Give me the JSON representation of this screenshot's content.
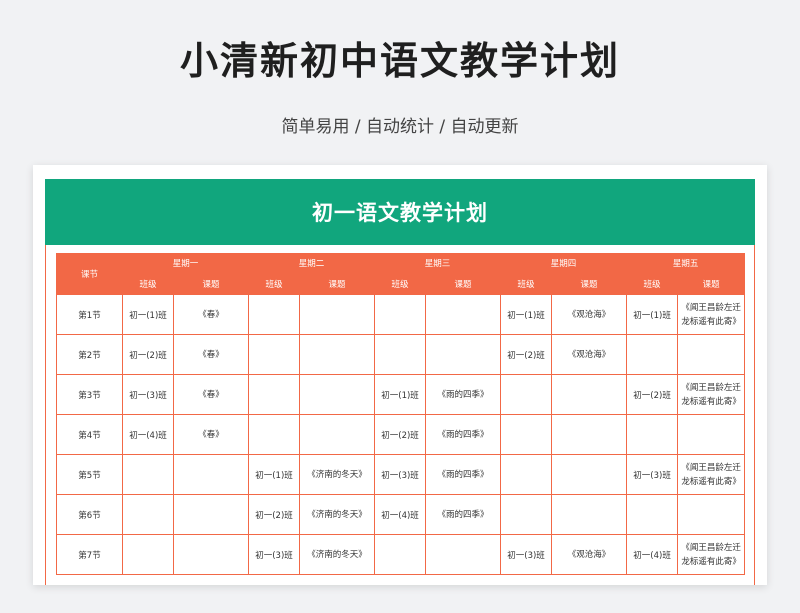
{
  "header": {
    "title": "小清新初中语文教学计划",
    "subtitle": "简单易用 / 自动统计 / 自动更新"
  },
  "sheet": {
    "banner": "初一语文教学计划",
    "corner_label": "课节",
    "days": [
      "星期一",
      "星期二",
      "星期三",
      "星期四",
      "星期五"
    ],
    "class_label": "班级",
    "topic_label": "课题",
    "rows": [
      {
        "period": "第1节",
        "cells": [
          [
            "初一(1)班",
            "《春》"
          ],
          [
            "",
            ""
          ],
          [
            "",
            ""
          ],
          [
            "初一(1)班",
            "《观沧海》"
          ],
          [
            "初一(1)班",
            "《闻王昌龄左迁龙标遥有此寄》"
          ]
        ]
      },
      {
        "period": "第2节",
        "cells": [
          [
            "初一(2)班",
            "《春》"
          ],
          [
            "",
            ""
          ],
          [
            "",
            ""
          ],
          [
            "初一(2)班",
            "《观沧海》"
          ],
          [
            "",
            ""
          ]
        ]
      },
      {
        "period": "第3节",
        "cells": [
          [
            "初一(3)班",
            "《春》"
          ],
          [
            "",
            ""
          ],
          [
            "初一(1)班",
            "《雨的四季》"
          ],
          [
            "",
            ""
          ],
          [
            "初一(2)班",
            "《闻王昌龄左迁龙标遥有此寄》"
          ]
        ]
      },
      {
        "period": "第4节",
        "cells": [
          [
            "初一(4)班",
            "《春》"
          ],
          [
            "",
            ""
          ],
          [
            "初一(2)班",
            "《雨的四季》"
          ],
          [
            "",
            ""
          ],
          [
            "",
            ""
          ]
        ]
      },
      {
        "period": "第5节",
        "cells": [
          [
            "",
            ""
          ],
          [
            "初一(1)班",
            "《济南的冬天》"
          ],
          [
            "初一(3)班",
            "《雨的四季》"
          ],
          [
            "",
            ""
          ],
          [
            "初一(3)班",
            "《闻王昌龄左迁龙标遥有此寄》"
          ]
        ]
      },
      {
        "period": "第6节",
        "cells": [
          [
            "",
            ""
          ],
          [
            "初一(2)班",
            "《济南的冬天》"
          ],
          [
            "初一(4)班",
            "《雨的四季》"
          ],
          [
            "",
            ""
          ],
          [
            "",
            ""
          ]
        ]
      },
      {
        "period": "第7节",
        "cells": [
          [
            "",
            ""
          ],
          [
            "初一(3)班",
            "《济南的冬天》"
          ],
          [
            "",
            ""
          ],
          [
            "初一(3)班",
            "《观沧海》"
          ],
          [
            "初一(4)班",
            "《闻王昌龄左迁龙标遥有此寄》"
          ]
        ]
      }
    ]
  },
  "colors": {
    "banner_green": "#11a67d",
    "grid_orange": "#f26846",
    "background": "#f1f2f4"
  }
}
